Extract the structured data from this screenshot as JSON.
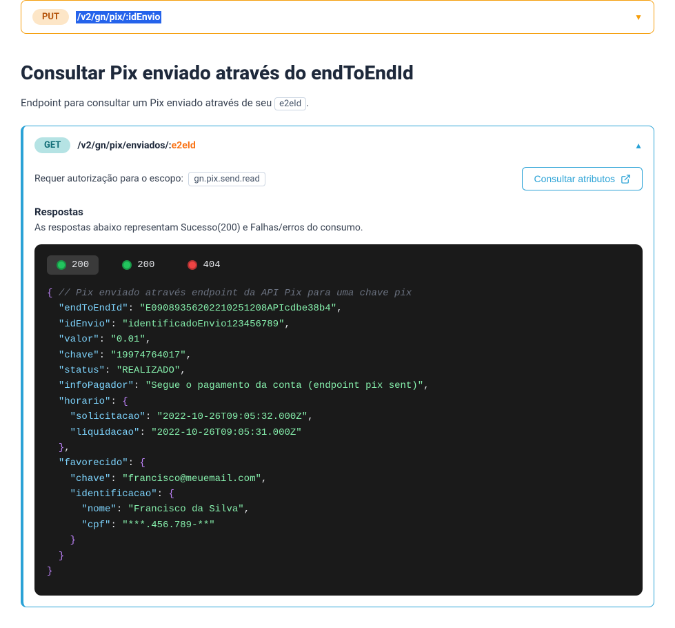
{
  "putCard": {
    "method": "PUT",
    "path": "/v2/gn/pix/:idEnvio"
  },
  "section": {
    "title": "Consultar Pix enviado através do endToEndId",
    "descPrefix": "Endpoint para consultar um Pix enviado através de seu ",
    "descCode": "e2eId",
    "descSuffix": "."
  },
  "getCard": {
    "method": "GET",
    "pathPrefix": "/v2/gn/pix/enviados/:",
    "pathParam": "e2eId",
    "scopeLabel": "Requer autorização para o escopo:",
    "scope": "gn.pix.send.read",
    "attrBtn": "Consultar atributos",
    "respTitle": "Respostas",
    "respDesc": "As respostas abaixo representam Sucesso(200) e Falhas/erros do consumo.",
    "tabs": [
      {
        "status": "200",
        "color": "green",
        "active": true
      },
      {
        "status": "200",
        "color": "green",
        "active": false
      },
      {
        "status": "404",
        "color": "red",
        "active": false
      }
    ],
    "json": {
      "comment": "// Pix enviado através endpoint da API Pix para uma chave pix",
      "endToEndId": "E09089356202210251208APIcdbe38b4",
      "idEnvio": "identificadoEnvio123456789",
      "valor": "0.01",
      "chave": "19974764017",
      "status": "REALIZADO",
      "infoPagador": "Segue o pagamento da conta (endpoint pix sent)",
      "horario": {
        "solicitacao": "2022-10-26T09:05:32.000Z",
        "liquidacao": "2022-10-26T09:05:31.000Z"
      },
      "favorecido": {
        "chave": "francisco@meuemail.com",
        "identificacao": {
          "nome": "Francisco da Silva",
          "cpf": "***.456.789-**"
        }
      }
    }
  }
}
